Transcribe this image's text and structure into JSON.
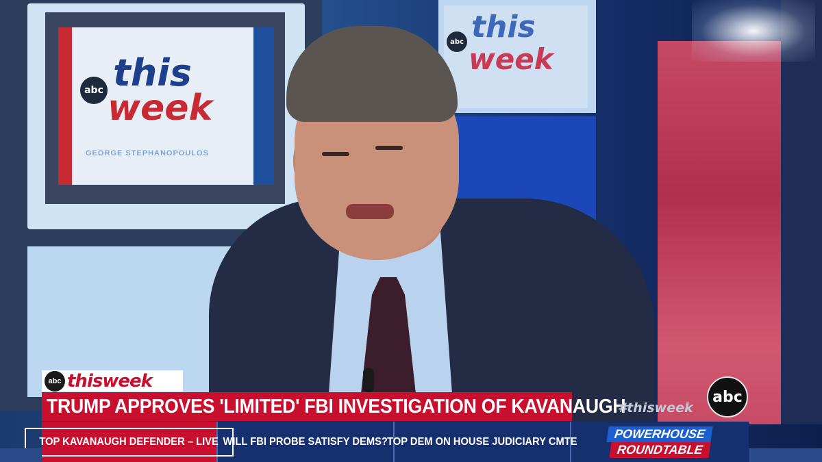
{
  "background": {
    "left_logo": {
      "abc": "abc",
      "line1": "this",
      "line2": "week",
      "host": "GEORGE STEPHANOPOULOS"
    },
    "right_logo": {
      "abc": "abc",
      "line1": "this",
      "line2": "week"
    }
  },
  "lower_third": {
    "show_tag": {
      "network": "abc",
      "show_name": "thisweek"
    },
    "headline": "TRUMP APPROVES 'LIMITED' FBI INVESTIGATION OF KAVANAUGH",
    "hashtag": "#thisweek",
    "network_bug": "abc"
  },
  "ticker": {
    "items": [
      {
        "label": "TOP KAVANAUGH DEFENDER – LIVE",
        "active": true
      },
      {
        "label": "WILL FBI PROBE SATISFY DEMS?",
        "active": false
      },
      {
        "label": "TOP DEM ON HOUSE JUDICIARY CMTE",
        "active": false
      }
    ],
    "roundtable": {
      "line1": "POWERHOUSE",
      "line2": "ROUNDTABLE"
    }
  },
  "colors": {
    "brand_red": "#c8102e",
    "ticker_blue": "#16306f",
    "logo_blue": "#1d4f9c"
  }
}
